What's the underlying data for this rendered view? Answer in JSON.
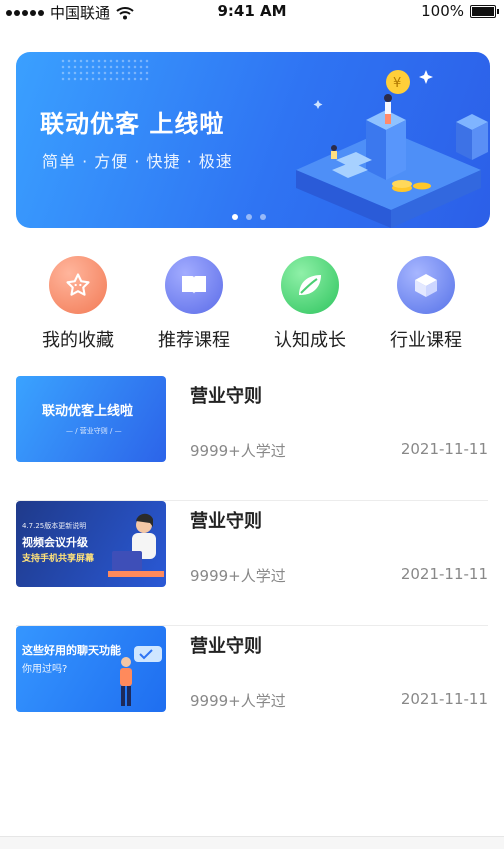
{
  "status_bar": {
    "carrier": "中国联通",
    "time": "9:41 AM",
    "battery": "100%"
  },
  "banner": {
    "title": "联动优客  上线啦",
    "subtitle": "简单 · 方便 · 快捷 · 极速",
    "pages": 3,
    "active_page": 1
  },
  "quick_menu": [
    {
      "label": "我的收藏",
      "icon": "star-icon",
      "color": "#f2875f"
    },
    {
      "label": "推荐课程",
      "icon": "book-icon",
      "color": "#6d7ef0"
    },
    {
      "label": "认知成长",
      "icon": "leaf-icon",
      "color": "#3ecf6a"
    },
    {
      "label": "行业课程",
      "icon": "cube-icon",
      "color": "#6a83ef"
    }
  ],
  "courses": [
    {
      "title": "营业守则",
      "learners": "9999+人学过",
      "date": "2021-11-11",
      "thumb": {
        "line1": "联动优客上线啦",
        "line2": "— / 营业守则 / —"
      }
    },
    {
      "title": "营业守则",
      "learners": "9999+人学过",
      "date": "2021-11-11",
      "thumb": {
        "line0": "4.7.25版本更新说明",
        "line1": "视频会议升级",
        "line2": "支持手机共享屏幕"
      }
    },
    {
      "title": "营业守则",
      "learners": "9999+人学过",
      "date": "2021-11-11",
      "thumb": {
        "line1": "这些好用的聊天功能",
        "line2": "你用过吗?"
      }
    }
  ]
}
